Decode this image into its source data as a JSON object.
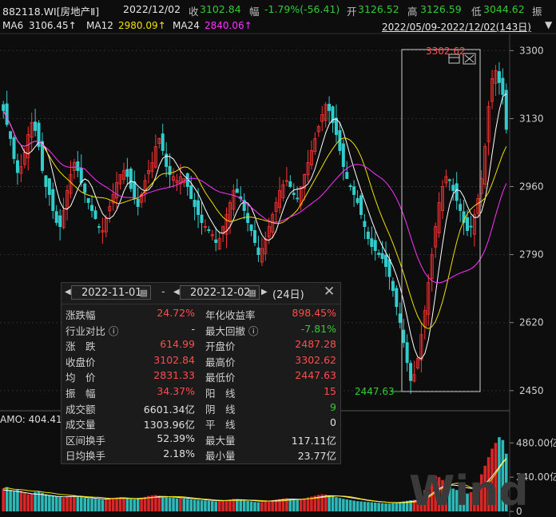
{
  "header": {
    "code": "882118.WI[房地产Ⅱ]",
    "date": "2022/12/02",
    "close_label": "收",
    "close": "3102.84",
    "change_label": "幅",
    "change": "-1.79%(-56.41)",
    "open_label": "开",
    "open": "3126.52",
    "high_label": "高",
    "high": "3126.59",
    "low_label": "低",
    "low": "3044.62",
    "amp_label": "振"
  },
  "ma_bar": {
    "ma6_label": "MA6",
    "ma6": "3106.45↑",
    "ma12_label": "MA12",
    "ma12": "2980.09↑",
    "ma24_label": "MA24",
    "ma24": "2840.06↑",
    "range": "2022/05/09-2022/12/02(143日)"
  },
  "colors": {
    "up": "#ff3333",
    "down": "#33cccc",
    "ma6": "#ffffff",
    "ma12": "#f0e000",
    "ma24": "#ff33ff",
    "green": "#33cc33",
    "red": "#ff4d4d"
  },
  "chart_data": {
    "type": "candlestick",
    "y_ticks": [
      "3300",
      "3130",
      "2960",
      "2790",
      "2620",
      "2450"
    ],
    "y_range": [
      2392,
      3320
    ],
    "annot_high": "3302.62",
    "annot_low": "2447.63",
    "volume_ticks": [
      "480.00亿",
      "240.00亿",
      "0"
    ],
    "volume_label": "AMO: 404.41",
    "watermark": "Wind",
    "closes": [
      3150,
      3115,
      3080,
      3030,
      2995,
      3010,
      3045,
      3090,
      3120,
      3100,
      3060,
      3000,
      2960,
      2940,
      2900,
      2870,
      2860,
      2900,
      2950,
      2990,
      3020,
      3000,
      2970,
      2945,
      2920,
      2900,
      2880,
      2860,
      2850,
      2880,
      2910,
      2940,
      2970,
      2990,
      3000,
      2985,
      2955,
      2930,
      2910,
      2940,
      2975,
      3000,
      3020,
      3060,
      3080,
      3050,
      3010,
      2990,
      2985,
      2975,
      2985,
      2980,
      2960,
      2930,
      2910,
      2890,
      2870,
      2860,
      2850,
      2840,
      2820,
      2830,
      2860,
      2890,
      2920,
      2950,
      2945,
      2930,
      2900,
      2870,
      2850,
      2820,
      2790,
      2805,
      2830,
      2860,
      2890,
      2920,
      2950,
      2965,
      2975,
      2960,
      2940,
      2930,
      2960,
      2990,
      3020,
      3050,
      3080,
      3110,
      3140,
      3165,
      3150,
      3120,
      3090,
      3050,
      3010,
      2980,
      2960,
      2940,
      2920,
      2890,
      2860,
      2830,
      2810,
      2800,
      2790,
      2780,
      2760,
      2735,
      2700,
      2660,
      2620,
      2570,
      2520,
      2475,
      2490,
      2530,
      2590,
      2650,
      2720,
      2790,
      2860,
      2920,
      2960,
      2985,
      2975,
      2950,
      2925,
      2900,
      2870,
      2850,
      2860,
      2890,
      2930,
      2980,
      3060,
      3160,
      3230,
      3250,
      3220,
      3190,
      3103
    ],
    "volumes": [
      160,
      170,
      150,
      140,
      150,
      145,
      130,
      120,
      125,
      135,
      140,
      130,
      120,
      115,
      110,
      105,
      100,
      95,
      105,
      110,
      115,
      108,
      100,
      95,
      92,
      90,
      88,
      85,
      82,
      86,
      90,
      95,
      98,
      100,
      96,
      92,
      88,
      85,
      90,
      96,
      102,
      108,
      112,
      115,
      110,
      105,
      100,
      98,
      95,
      92,
      94,
      90,
      88,
      85,
      82,
      80,
      78,
      76,
      74,
      72,
      70,
      72,
      76,
      80,
      84,
      88,
      86,
      82,
      78,
      74,
      70,
      66,
      64,
      66,
      70,
      74,
      78,
      82,
      86,
      90,
      92,
      88,
      84,
      80,
      86,
      92,
      98,
      104,
      110,
      116,
      120,
      118,
      112,
      106,
      100,
      94,
      88,
      84,
      80,
      76,
      72,
      70,
      68,
      66,
      64,
      62,
      60,
      58,
      56,
      55,
      58,
      62,
      66,
      70,
      74,
      78,
      82,
      90,
      110,
      150,
      190,
      230,
      250,
      240,
      220,
      200,
      180,
      160,
      150,
      140,
      130,
      125,
      135,
      160,
      200,
      260,
      320,
      380,
      440,
      480,
      520,
      500,
      404.41
    ],
    "ma_vol": [
      150,
      148,
      146,
      144,
      140,
      136,
      132,
      128,
      124,
      122,
      120,
      118,
      115,
      112,
      109,
      106,
      104,
      102,
      103,
      104,
      106,
      105,
      103,
      100,
      97,
      95,
      92,
      90,
      88,
      87,
      88,
      90,
      92,
      94,
      95,
      94,
      92,
      90,
      89,
      90,
      92,
      95,
      98,
      101,
      104,
      105,
      104,
      103,
      101,
      99,
      97,
      95,
      93,
      91,
      89,
      87,
      85,
      82,
      80,
      78,
      76,
      75,
      75,
      76,
      78,
      80,
      82,
      82,
      81,
      79,
      77,
      75,
      73,
      72,
      72,
      73,
      75,
      77,
      79,
      82,
      84,
      86,
      86,
      85,
      85,
      86,
      88,
      91,
      95,
      99,
      103,
      107,
      110,
      110,
      109,
      107,
      104,
      101,
      97,
      93,
      89,
      85,
      81,
      77,
      74,
      71,
      69,
      67,
      65,
      63,
      62,
      62,
      63,
      64,
      66,
      69,
      72,
      76,
      82,
      92,
      106,
      124,
      144,
      160,
      172,
      180,
      184,
      184,
      182,
      178,
      172,
      166,
      162,
      162,
      166,
      176,
      194,
      218,
      246,
      278,
      312,
      346,
      370
    ]
  },
  "panel": {
    "start_date": "2022-11-01",
    "dash": "-",
    "end_date": "2022-12-02",
    "days": "(24日)",
    "rows": [
      {
        "l1": "涨跌幅",
        "v1": "24.72%",
        "l2": "年化收益率",
        "v2": "898.45%"
      },
      {
        "l1": "行业对比",
        "v1": "-",
        "l2": "最大回撤",
        "v2": "-7.81%"
      },
      {
        "l1": "涨　跌",
        "v1": "614.99",
        "l2": "开盘价",
        "v2": "2487.28"
      },
      {
        "l1": "收盘价",
        "v1": "3102.84",
        "l2": "最高价",
        "v2": "3302.62"
      },
      {
        "l1": "均　价",
        "v1": "2831.33",
        "l2": "最低价",
        "v2": "2447.63"
      },
      {
        "l1": "振　幅",
        "v1": "34.37%",
        "l2": "阳　线",
        "v2": "15"
      },
      {
        "l1": "成交额",
        "v1": "6601.34亿",
        "l2": "阴　线",
        "v2": "9"
      },
      {
        "l1": "成交量",
        "v1": "1303.96亿",
        "l2": "平　线",
        "v2": "0"
      },
      {
        "l1": "区间换手",
        "v1": "52.39%",
        "l2": "最大量",
        "v2": "117.11亿"
      },
      {
        "l1": "日均换手",
        "v1": "2.18%",
        "l2": "最小量",
        "v2": "23.77亿"
      }
    ]
  }
}
